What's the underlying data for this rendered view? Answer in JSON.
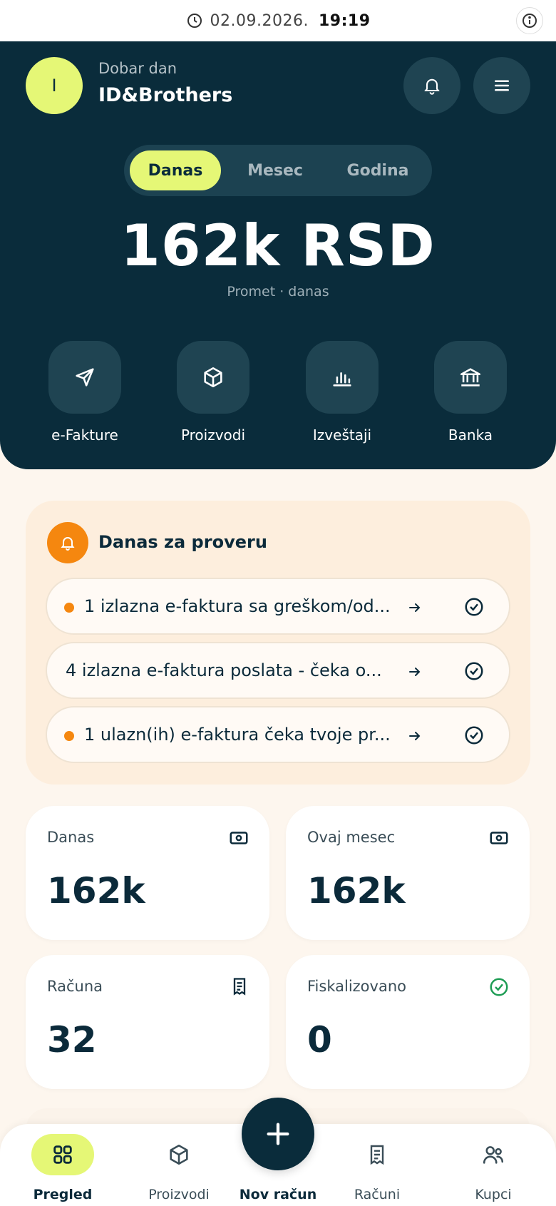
{
  "status_bar": {
    "date": "02.09.2026.",
    "time": "19:19"
  },
  "header": {
    "avatar_initial": "I",
    "greeting": "Dobar dan",
    "company": "ID&Brothers"
  },
  "period_tabs": [
    {
      "label": "Danas",
      "selected": true
    },
    {
      "label": "Mesec",
      "selected": false
    },
    {
      "label": "Godina",
      "selected": false
    }
  ],
  "turnover": {
    "amount": "162k RSD",
    "caption": "Promet · danas"
  },
  "quick_actions": [
    {
      "label": "e-Fakture",
      "icon": "send-icon"
    },
    {
      "label": "Proizvodi",
      "icon": "box-icon"
    },
    {
      "label": "Izveštaji",
      "icon": "bar-chart-icon"
    },
    {
      "label": "Banka",
      "icon": "bank-icon"
    }
  ],
  "review": {
    "title": "Danas za proveru",
    "items": [
      {
        "text": "1 izlazna e-faktura sa greškom/od...",
        "alert": true
      },
      {
        "text": "4 izlazna e-faktura poslata - čeka o...",
        "alert": false
      },
      {
        "text": "1 ulazn(ih) e-faktura čeka tvoje pr...",
        "alert": true
      }
    ]
  },
  "stats": [
    {
      "label": "Danas",
      "value": "162k",
      "icon": "cash-icon"
    },
    {
      "label": "Ovaj mesec",
      "value": "162k",
      "icon": "cash-icon"
    },
    {
      "label": "Računa",
      "value": "32",
      "icon": "receipt-icon"
    },
    {
      "label": "Fiskalizovano",
      "value": "0",
      "icon": "check-circle-icon"
    }
  ],
  "bottom_nav": [
    {
      "label": "Pregled",
      "icon": "grid-icon",
      "active": true
    },
    {
      "label": "Proizvodi",
      "icon": "box-icon",
      "active": false
    },
    {
      "label": "Nov račun",
      "icon": "plus-icon",
      "active": false
    },
    {
      "label": "Računi",
      "icon": "receipt-icon",
      "active": false
    },
    {
      "label": "Kupci",
      "icon": "users-icon",
      "active": false
    }
  ],
  "colors": {
    "primary_dark": "#0a2c3b",
    "accent_lime": "#e5f776",
    "accent_orange": "#f5870f",
    "background": "#fdf6ee",
    "success_green": "#1f9d55"
  }
}
